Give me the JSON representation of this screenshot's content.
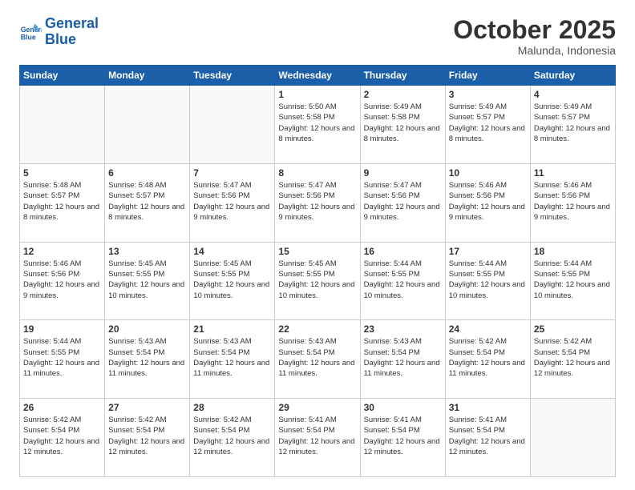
{
  "logo": {
    "line1": "General",
    "line2": "Blue"
  },
  "header": {
    "month": "October 2025",
    "location": "Malunda, Indonesia"
  },
  "days_of_week": [
    "Sunday",
    "Monday",
    "Tuesday",
    "Wednesday",
    "Thursday",
    "Friday",
    "Saturday"
  ],
  "weeks": [
    [
      {
        "day": "",
        "info": ""
      },
      {
        "day": "",
        "info": ""
      },
      {
        "day": "",
        "info": ""
      },
      {
        "day": "1",
        "info": "Sunrise: 5:50 AM\nSunset: 5:58 PM\nDaylight: 12 hours\nand 8 minutes."
      },
      {
        "day": "2",
        "info": "Sunrise: 5:49 AM\nSunset: 5:58 PM\nDaylight: 12 hours\nand 8 minutes."
      },
      {
        "day": "3",
        "info": "Sunrise: 5:49 AM\nSunset: 5:57 PM\nDaylight: 12 hours\nand 8 minutes."
      },
      {
        "day": "4",
        "info": "Sunrise: 5:49 AM\nSunset: 5:57 PM\nDaylight: 12 hours\nand 8 minutes."
      }
    ],
    [
      {
        "day": "5",
        "info": "Sunrise: 5:48 AM\nSunset: 5:57 PM\nDaylight: 12 hours\nand 8 minutes."
      },
      {
        "day": "6",
        "info": "Sunrise: 5:48 AM\nSunset: 5:57 PM\nDaylight: 12 hours\nand 8 minutes."
      },
      {
        "day": "7",
        "info": "Sunrise: 5:47 AM\nSunset: 5:56 PM\nDaylight: 12 hours\nand 9 minutes."
      },
      {
        "day": "8",
        "info": "Sunrise: 5:47 AM\nSunset: 5:56 PM\nDaylight: 12 hours\nand 9 minutes."
      },
      {
        "day": "9",
        "info": "Sunrise: 5:47 AM\nSunset: 5:56 PM\nDaylight: 12 hours\nand 9 minutes."
      },
      {
        "day": "10",
        "info": "Sunrise: 5:46 AM\nSunset: 5:56 PM\nDaylight: 12 hours\nand 9 minutes."
      },
      {
        "day": "11",
        "info": "Sunrise: 5:46 AM\nSunset: 5:56 PM\nDaylight: 12 hours\nand 9 minutes."
      }
    ],
    [
      {
        "day": "12",
        "info": "Sunrise: 5:46 AM\nSunset: 5:56 PM\nDaylight: 12 hours\nand 9 minutes."
      },
      {
        "day": "13",
        "info": "Sunrise: 5:45 AM\nSunset: 5:55 PM\nDaylight: 12 hours\nand 10 minutes."
      },
      {
        "day": "14",
        "info": "Sunrise: 5:45 AM\nSunset: 5:55 PM\nDaylight: 12 hours\nand 10 minutes."
      },
      {
        "day": "15",
        "info": "Sunrise: 5:45 AM\nSunset: 5:55 PM\nDaylight: 12 hours\nand 10 minutes."
      },
      {
        "day": "16",
        "info": "Sunrise: 5:44 AM\nSunset: 5:55 PM\nDaylight: 12 hours\nand 10 minutes."
      },
      {
        "day": "17",
        "info": "Sunrise: 5:44 AM\nSunset: 5:55 PM\nDaylight: 12 hours\nand 10 minutes."
      },
      {
        "day": "18",
        "info": "Sunrise: 5:44 AM\nSunset: 5:55 PM\nDaylight: 12 hours\nand 10 minutes."
      }
    ],
    [
      {
        "day": "19",
        "info": "Sunrise: 5:44 AM\nSunset: 5:55 PM\nDaylight: 12 hours\nand 11 minutes."
      },
      {
        "day": "20",
        "info": "Sunrise: 5:43 AM\nSunset: 5:54 PM\nDaylight: 12 hours\nand 11 minutes."
      },
      {
        "day": "21",
        "info": "Sunrise: 5:43 AM\nSunset: 5:54 PM\nDaylight: 12 hours\nand 11 minutes."
      },
      {
        "day": "22",
        "info": "Sunrise: 5:43 AM\nSunset: 5:54 PM\nDaylight: 12 hours\nand 11 minutes."
      },
      {
        "day": "23",
        "info": "Sunrise: 5:43 AM\nSunset: 5:54 PM\nDaylight: 12 hours\nand 11 minutes."
      },
      {
        "day": "24",
        "info": "Sunrise: 5:42 AM\nSunset: 5:54 PM\nDaylight: 12 hours\nand 11 minutes."
      },
      {
        "day": "25",
        "info": "Sunrise: 5:42 AM\nSunset: 5:54 PM\nDaylight: 12 hours\nand 12 minutes."
      }
    ],
    [
      {
        "day": "26",
        "info": "Sunrise: 5:42 AM\nSunset: 5:54 PM\nDaylight: 12 hours\nand 12 minutes."
      },
      {
        "day": "27",
        "info": "Sunrise: 5:42 AM\nSunset: 5:54 PM\nDaylight: 12 hours\nand 12 minutes."
      },
      {
        "day": "28",
        "info": "Sunrise: 5:42 AM\nSunset: 5:54 PM\nDaylight: 12 hours\nand 12 minutes."
      },
      {
        "day": "29",
        "info": "Sunrise: 5:41 AM\nSunset: 5:54 PM\nDaylight: 12 hours\nand 12 minutes."
      },
      {
        "day": "30",
        "info": "Sunrise: 5:41 AM\nSunset: 5:54 PM\nDaylight: 12 hours\nand 12 minutes."
      },
      {
        "day": "31",
        "info": "Sunrise: 5:41 AM\nSunset: 5:54 PM\nDaylight: 12 hours\nand 12 minutes."
      },
      {
        "day": "",
        "info": ""
      }
    ]
  ]
}
